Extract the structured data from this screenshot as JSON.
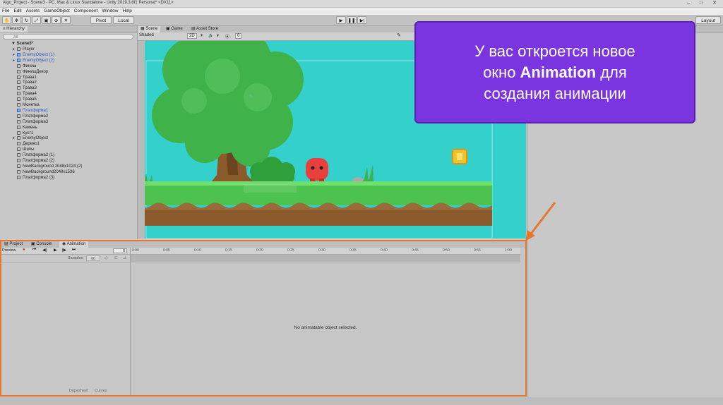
{
  "window": {
    "title": "Algo_Project - Scene3 - PC, Mac & Linux Standalone - Unity 2019.3.6f1 Personal* <DX11>",
    "controls": [
      "–",
      "□",
      "✕"
    ]
  },
  "menu": [
    "File",
    "Edit",
    "Assets",
    "GameObject",
    "Component",
    "Window",
    "Help"
  ],
  "toolbar": {
    "pivot_label": "Pivot",
    "local_label": "Local",
    "layout_label": "Layout"
  },
  "hierarchy": {
    "tab_label": "Hierarchy",
    "search_placeholder": "All",
    "scene_name": "Scene3*",
    "items": [
      {
        "label": "Player",
        "blue": false,
        "expand": true
      },
      {
        "label": "EnemyObject (1)",
        "blue": true,
        "expand": true
      },
      {
        "label": "EnemyObject (2)",
        "blue": true,
        "expand": true
      },
      {
        "label": "Финиш",
        "blue": false,
        "expand": false
      },
      {
        "label": "ФинишДекор",
        "blue": false,
        "expand": false
      },
      {
        "label": "Трава1",
        "blue": false,
        "expand": false
      },
      {
        "label": "Трава2",
        "blue": false,
        "expand": false
      },
      {
        "label": "Трава3",
        "blue": false,
        "expand": false
      },
      {
        "label": "Трава4",
        "blue": false,
        "expand": false
      },
      {
        "label": "Трава5",
        "blue": false,
        "expand": false
      },
      {
        "label": "Монетка",
        "blue": false,
        "expand": false
      },
      {
        "label": "Платформа1",
        "blue": true,
        "expand": false
      },
      {
        "label": "Платформа2",
        "blue": false,
        "expand": false
      },
      {
        "label": "Платформа3",
        "blue": false,
        "expand": false
      },
      {
        "label": "Камень",
        "blue": false,
        "expand": false
      },
      {
        "label": "Куст1",
        "blue": false,
        "expand": false
      },
      {
        "label": "EnemyObject",
        "blue": false,
        "expand": true
      },
      {
        "label": "Дерево1",
        "blue": false,
        "expand": false
      },
      {
        "label": "Шипы",
        "blue": false,
        "expand": false
      },
      {
        "label": "Платформа2 (1)",
        "blue": false,
        "expand": false
      },
      {
        "label": "Платформа2 (2)",
        "blue": false,
        "expand": false
      },
      {
        "label": "NewBackground 2048x1024 (2)",
        "blue": false,
        "expand": false
      },
      {
        "label": "NewBackground2048x1536",
        "blue": false,
        "expand": false
      },
      {
        "label": "Платформа2 (3)",
        "blue": false,
        "expand": false
      }
    ]
  },
  "scene": {
    "tabs": [
      "Scene",
      "Game",
      "Asset Store"
    ],
    "shading_mode": "Shaded",
    "mode_2d": "2D",
    "gizmo_count": "0"
  },
  "bottom_tabs": [
    "Project",
    "Console",
    "Animation"
  ],
  "animation": {
    "preview_label": "Preview",
    "samples_label": "Samples",
    "samples_value": "60",
    "frame_value": "0",
    "ruler_ticks": [
      "0:00",
      "0:05",
      "0:10",
      "0:15",
      "0:20",
      "0:25",
      "0:30",
      "0:35",
      "0:40",
      "0:45",
      "0:50",
      "0:55",
      "1:00"
    ],
    "empty_message": "No animatable object selected.",
    "footer_tabs": [
      "Dopesheet",
      "Curves"
    ]
  },
  "callout": {
    "line1": "У вас откроется новое",
    "line2_pre": "окно ",
    "line2_bold": "Animation",
    "line2_post": " для",
    "line3": "создания анимации",
    "bg_color": "#7a35e0",
    "text_color": "#ffffff"
  },
  "highlight_color": "#e8772e"
}
